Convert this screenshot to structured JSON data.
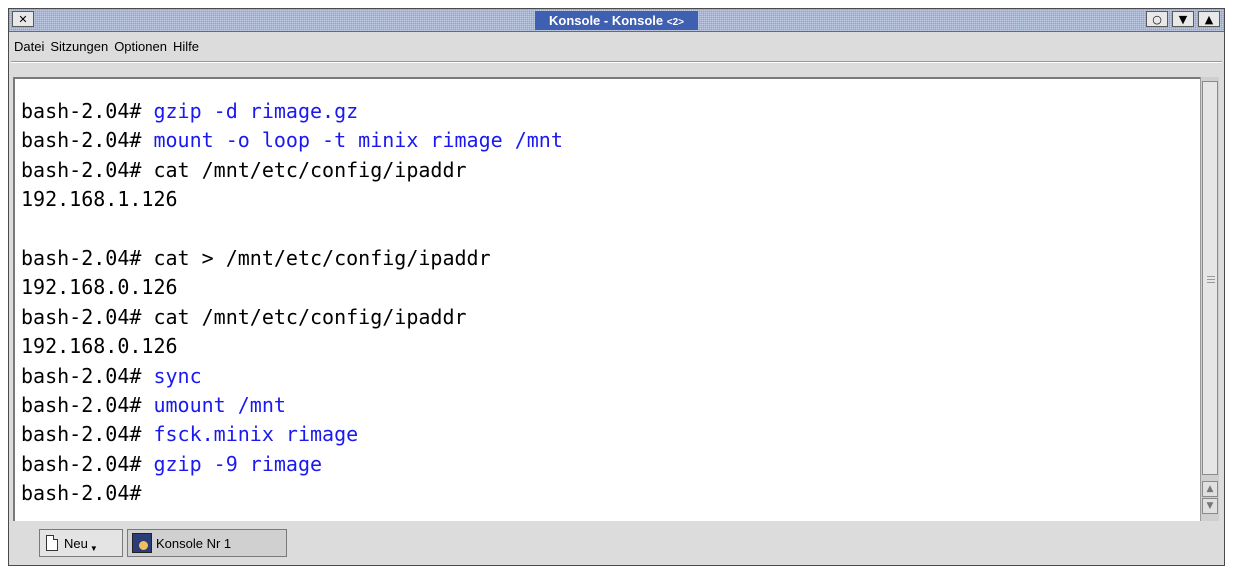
{
  "window": {
    "title": "Konsole - Konsole",
    "title_suffix": "<2>"
  },
  "titlebar_buttons": {
    "close": "✕",
    "circle": "○",
    "shade": "▼",
    "max": "▲"
  },
  "menu": {
    "items": [
      "Datei",
      "Sitzungen",
      "Optionen",
      "Hilfe"
    ]
  },
  "terminal": {
    "prompt": "bash-2.04#",
    "lines": [
      {
        "type": "cmd",
        "text": " gzip -d rimage.gz",
        "color": "blue"
      },
      {
        "type": "cmd",
        "text": " mount -o loop -t minix rimage /mnt",
        "color": "blue"
      },
      {
        "type": "cmd",
        "text": " cat /mnt/etc/config/ipaddr",
        "color": "black"
      },
      {
        "type": "out",
        "text": "192.168.1.126"
      },
      {
        "type": "blank",
        "text": ""
      },
      {
        "type": "cmd",
        "text": " cat > /mnt/etc/config/ipaddr",
        "color": "black"
      },
      {
        "type": "out",
        "text": "192.168.0.126"
      },
      {
        "type": "cmd",
        "text": " cat /mnt/etc/config/ipaddr",
        "color": "black"
      },
      {
        "type": "out",
        "text": "192.168.0.126"
      },
      {
        "type": "cmd",
        "text": " sync",
        "color": "blue"
      },
      {
        "type": "cmd",
        "text": " umount /mnt",
        "color": "blue"
      },
      {
        "type": "cmd",
        "text": " fsck.minix rimage",
        "color": "blue"
      },
      {
        "type": "cmd",
        "text": " gzip -9 rimage",
        "color": "blue"
      },
      {
        "type": "cmd",
        "text": "",
        "color": "black"
      }
    ]
  },
  "tabs": {
    "new_label": "Neu",
    "session_label": "Konsole Nr 1"
  },
  "colors": {
    "command_blue": "#1a1af0",
    "title_bg": "#3f5fb0"
  }
}
